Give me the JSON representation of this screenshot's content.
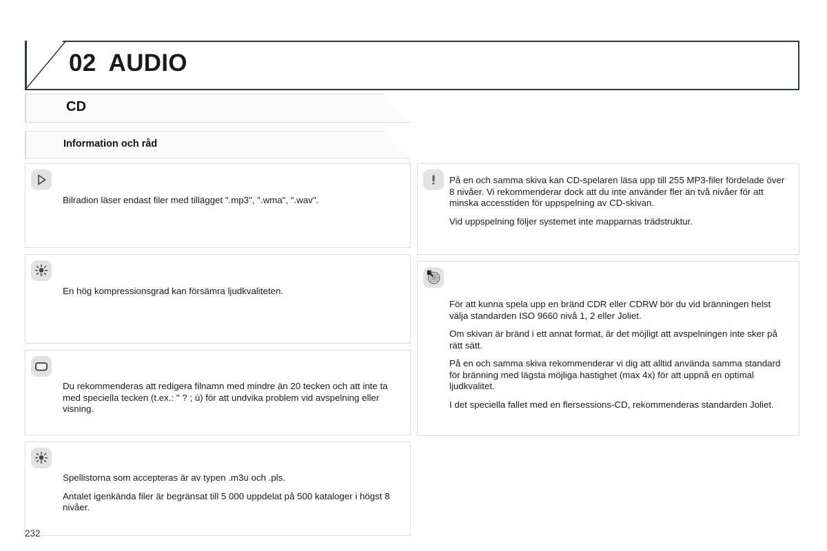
{
  "header": {
    "chapter_number": "02",
    "chapter_title": "AUDIO"
  },
  "sections": {
    "primary": "CD",
    "secondary": "Information och råd"
  },
  "left_column": [
    {
      "icon": "play-triangle-icon",
      "paragraphs": [
        "Bilradion läser endast filer med tillägget \".mp3\", \".wma\", \".wav\"."
      ]
    },
    {
      "icon": "lightbulb-tip-icon",
      "paragraphs": [
        "En hög kompressionsgrad kan försämra ljudkvaliteten."
      ]
    },
    {
      "icon": "display-screen-icon",
      "paragraphs": [
        "Du rekommenderas att redigera filnamn med mindre än 20 tecken och att inte ta med speciella tecken (t.ex.: \" ? ; ù) för att undvika problem vid avspelning eller visning."
      ]
    },
    {
      "icon": "lightbulb-tip-icon",
      "paragraphs": [
        "Spellistorna som accepteras är av typen .m3u och .pls.",
        "Antalet igenkända filer är begränsat till 5 000 uppdelat på 500 kataloger i högst 8 nivåer."
      ]
    }
  ],
  "right_column": [
    {
      "icon": "warning-exclamation-icon",
      "paragraphs": [
        "På en och samma skiva kan CD-spelaren läsa upp till 255 MP3-filer fördelade över 8 nivåer. Vi rekommenderar dock att du inte använder fler än två nivåer för att minska accesstiden för uppspelning av CD-skivan.",
        "Vid uppspelning följer systemet inte mapparnas trädstruktur."
      ]
    },
    {
      "icon": "cd-disc-eject-icon",
      "paragraphs": [
        "För att kunna spela upp en bränd CDR eller CDRW bör du vid bränningen helst välja standarden ISO 9660 nivå 1, 2 eller Joliet.",
        "Om skivan är bränd i ett annat format, är det möjligt att avspelningen inte sker på rätt sätt.",
        "På en och samma skiva rekommenderar vi dig att alltid använda samma standard för bränning med lägsta möjliga hastighet (max 4x) för att uppnå en optimal ljudkvalitet.",
        "I det speciella fallet med en flersessions-CD, rekommenderas standarden Joliet."
      ]
    }
  ],
  "footer": {
    "page_number": "232"
  },
  "colors": {
    "header_border": "#29384c",
    "box_border": "#dedede",
    "icon_badge": "#e2e2e2",
    "text": "#1a1a1a"
  }
}
